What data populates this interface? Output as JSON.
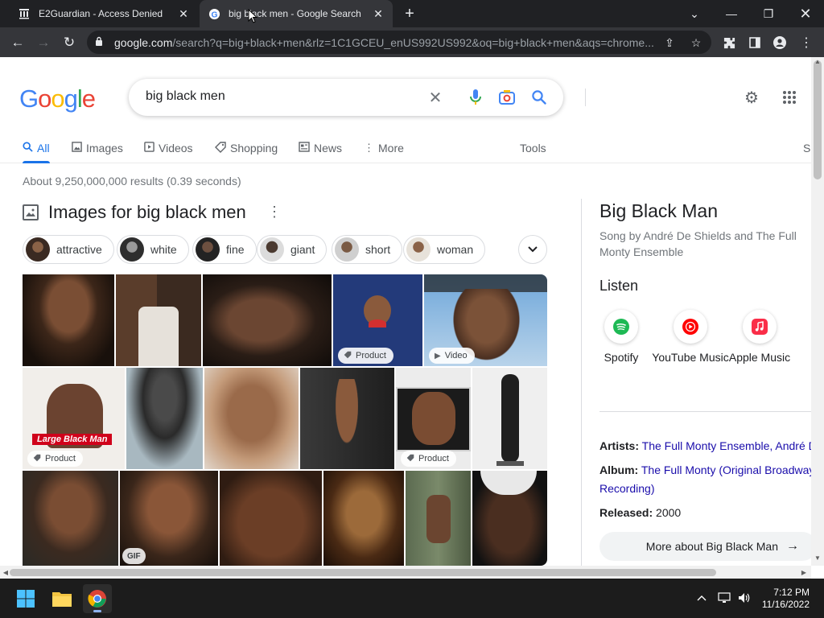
{
  "browser": {
    "tabs": [
      {
        "title": "E2Guardian - Access Denied",
        "active": false
      },
      {
        "title": "big black men - Google Search",
        "active": true
      }
    ],
    "new_tab_icon": "plus-icon",
    "url_domain": "google.com",
    "url_rest": "/search?q=big+black+men&rlz=1C1GCEU_enUS992US992&oq=big+black+men&aqs=chrome..."
  },
  "google": {
    "logo": [
      "G",
      "o",
      "o",
      "g",
      "l",
      "e"
    ],
    "logo_colors": [
      "#4285F4",
      "#EA4335",
      "#FBBC05",
      "#4285F4",
      "#34A853",
      "#EA4335"
    ],
    "query": "big black men",
    "tabs": [
      {
        "label": "All",
        "icon": "search-icon",
        "selected": true
      },
      {
        "label": "Images",
        "icon": "image-icon",
        "selected": false
      },
      {
        "label": "Videos",
        "icon": "play-icon",
        "selected": false
      },
      {
        "label": "Shopping",
        "icon": "tag-icon",
        "selected": false
      },
      {
        "label": "News",
        "icon": "newspaper-icon",
        "selected": false
      },
      {
        "label": "More",
        "icon": "more-vert-icon",
        "selected": false
      }
    ],
    "tools_label": "Tools",
    "cut_label": "S",
    "result_stats": "About 9,250,000,000 results (0.39 seconds)",
    "images_heading": "Images for big black men",
    "chips": [
      "attractive",
      "white",
      "fine",
      "giant",
      "short",
      "woman"
    ],
    "badges": {
      "product": "Product",
      "video": "Video",
      "gif": "GIF",
      "overlay": "Large Black Man"
    }
  },
  "knowledge_panel": {
    "title": "Big Black Man",
    "subtitle": "Song by André De Shields and The Full Monty Ensemble",
    "listen": "Listen",
    "services": [
      {
        "label": "Spotify",
        "color": "#1DB954"
      },
      {
        "label": "YouTube Music",
        "color": "#FF0000"
      },
      {
        "label": "Apple Music",
        "color": "#FA2D48"
      }
    ],
    "artists_label": "Artists:",
    "artists_value": "The Full Monty Ensemble, André D",
    "album_label": "Album:",
    "album_value_line1": "The Full Monty (Original Broadway",
    "album_value_line2": "Recording)",
    "released_label": "Released:",
    "released_value": "2000",
    "more_about": "More about Big Black Man"
  },
  "taskbar": {
    "time": "7:12 PM",
    "date": "11/16/2022"
  }
}
